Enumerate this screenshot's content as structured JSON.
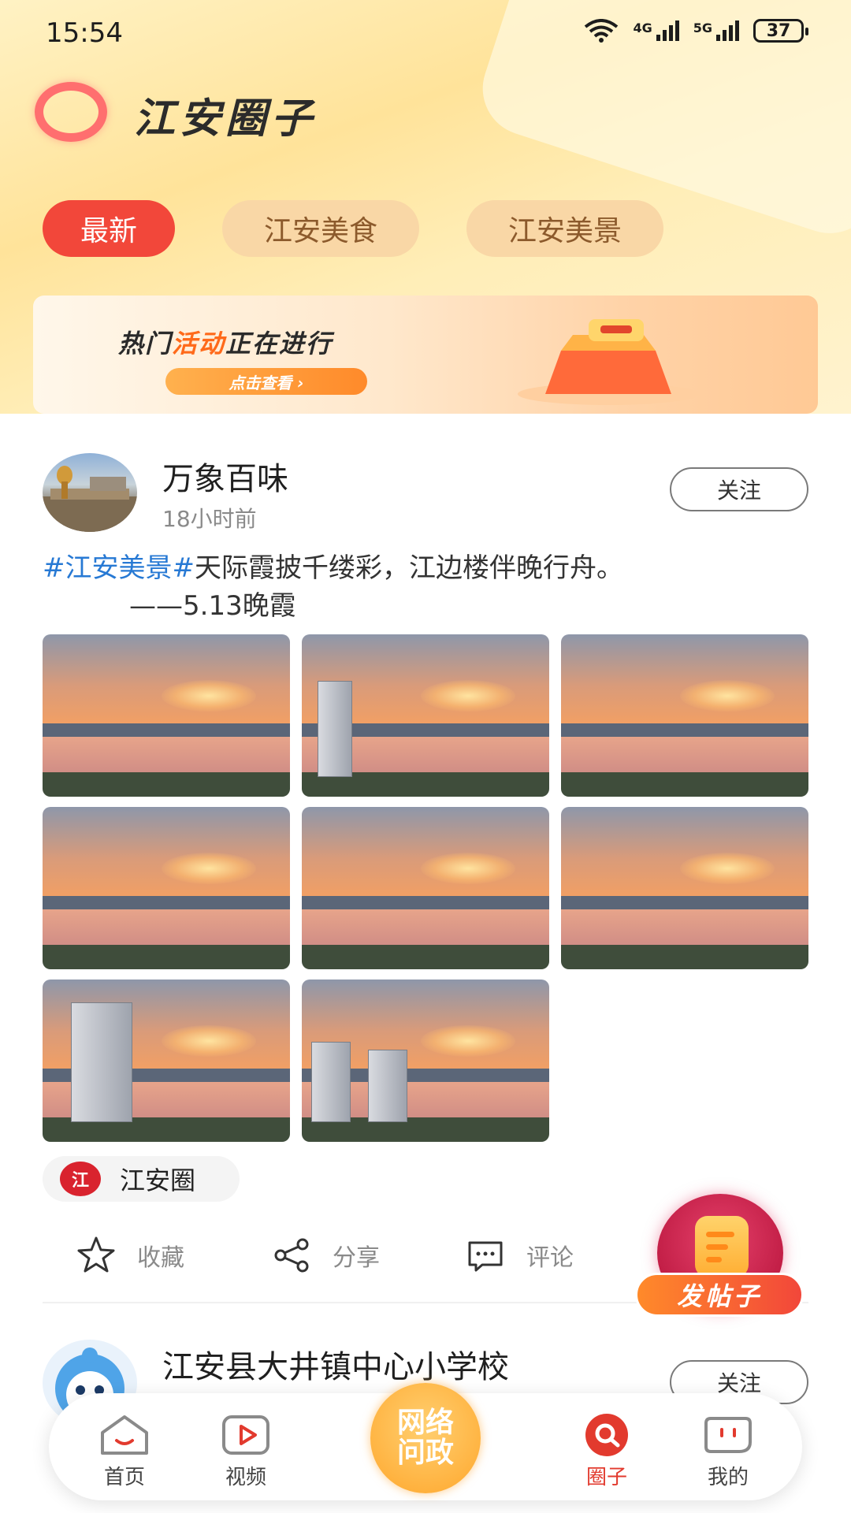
{
  "status_bar": {
    "time": "15:54",
    "network_1": "4G",
    "network_2": "5G",
    "battery": "37"
  },
  "header": {
    "app_title": "江安圈子"
  },
  "tabs": [
    {
      "label": "最新",
      "active": true
    },
    {
      "label": "江安美食",
      "active": false
    },
    {
      "label": "江安美景",
      "active": false
    }
  ],
  "banner": {
    "headline_a": "热门",
    "headline_b": "活动",
    "headline_c": "正在进行",
    "cta": "点击查看 ›"
  },
  "post": {
    "author": "万象百味",
    "time": "18小时前",
    "follow_label": "关注",
    "tag": "#江安美景#",
    "text_1": "天际霞披千缕彩，江边楼伴晚行舟。",
    "text_2": "——5.13晚霞",
    "image_count": 8,
    "circle_name": "江安圈",
    "circle_mark": "江",
    "actions": {
      "favorite": "收藏",
      "share": "分享",
      "comment": "评论"
    }
  },
  "post2": {
    "author": "江安县大井镇中心小学校",
    "follow_label": "关注"
  },
  "fab": {
    "label": "发帖子"
  },
  "bottom_nav": {
    "home": "首页",
    "video": "视频",
    "center": "网络问政",
    "circle": "圈子",
    "mine": "我的",
    "active": "圈子",
    "active_color": "#e23a2e"
  },
  "colors": {
    "accent": "#f2473a",
    "tag_blue": "#2779d4"
  }
}
